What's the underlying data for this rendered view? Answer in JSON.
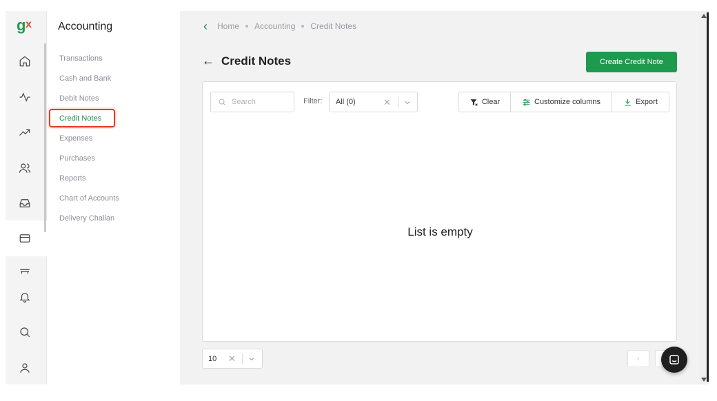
{
  "brand": {
    "logo_text": "gx",
    "color": "#1e9a4f"
  },
  "rail": {
    "items": [
      {
        "icon": "home-icon"
      },
      {
        "icon": "activity-icon"
      },
      {
        "icon": "trending-up-icon"
      },
      {
        "icon": "users-icon"
      },
      {
        "icon": "inbox-icon"
      },
      {
        "icon": "credit-card-icon",
        "active": true
      },
      {
        "icon": "store-icon"
      },
      {
        "icon": "bell-icon"
      },
      {
        "icon": "search-icon"
      },
      {
        "icon": "user-icon"
      }
    ]
  },
  "sidebar": {
    "title": "Accounting",
    "items": [
      {
        "label": "Transactions"
      },
      {
        "label": "Cash and Bank"
      },
      {
        "label": "Debit Notes"
      },
      {
        "label": "Credit Notes",
        "active": true
      },
      {
        "label": "Expenses"
      },
      {
        "label": "Purchases"
      },
      {
        "label": "Reports"
      },
      {
        "label": "Chart of Accounts"
      },
      {
        "label": "Delivery Challan"
      }
    ]
  },
  "breadcrumb": [
    "Home",
    "Accounting",
    "Credit Notes"
  ],
  "page": {
    "title": "Credit Notes",
    "create_label": "Create Credit Note"
  },
  "toolbar": {
    "search_placeholder": "Search",
    "filter_label": "Filter:",
    "filter_value": "All (0)",
    "clear_label": "Clear",
    "customize_label": "Customize columns",
    "export_label": "Export"
  },
  "list": {
    "empty_text": "List is empty"
  },
  "pagination": {
    "page_size": "10"
  }
}
